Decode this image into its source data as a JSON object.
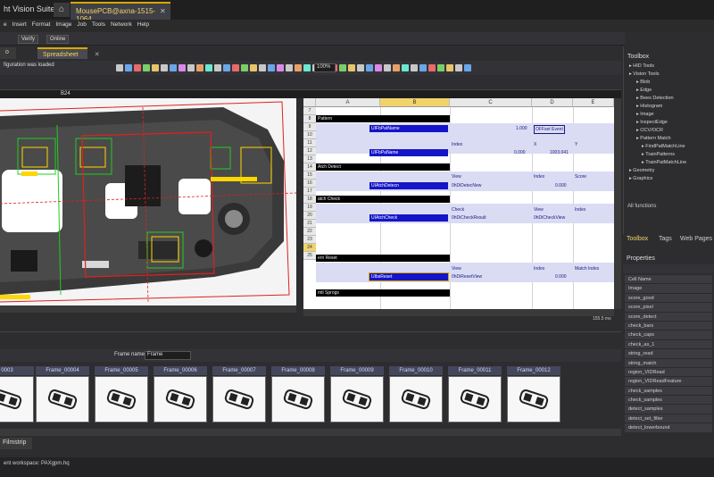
{
  "window": {
    "app_title": "ht Vision Suite",
    "doc_tab": "MousePCB@axna-1515-1064"
  },
  "menu": [
    "e",
    "Insert",
    "Format",
    "Image",
    "Job",
    "Tools",
    "Network",
    "Help"
  ],
  "toolbar": {
    "verify": "Verify",
    "online": "Online"
  },
  "tabs": [
    {
      "label": "o"
    },
    {
      "label": "Spreadsheet"
    }
  ],
  "status_message": "figuration was loaded",
  "zoom": "100%",
  "cell_ref": "B24",
  "sheet": {
    "columns": [
      "A",
      "B",
      "C",
      "D",
      "E"
    ],
    "rows": [
      "7",
      "8",
      "9",
      "10",
      "11",
      "12",
      "13",
      "14",
      "15",
      "16",
      "17",
      "18",
      "19",
      "20",
      "21",
      "22",
      "23",
      "24",
      "25"
    ],
    "bands": [
      "Pattern",
      "Atch Detect",
      "atch Check",
      "ern Reset",
      "mtl Sprogs"
    ],
    "blue_cells": [
      "UIFbPatName",
      "UIFbPaName",
      "UIAtchDetecn",
      "UIAtchCheck",
      "UIbsReset"
    ],
    "texts": {
      "r9_d": "1.000",
      "r9_e": "OFFset Event",
      "r10_c": "Index",
      "r10_d": "X",
      "r10_e": "Y",
      "r11_d": "0.000",
      "r11_e": "1003.041",
      "r13_c": "View",
      "r13_d": "Index",
      "r13_e": "Score",
      "r14_c": "0hDiDetecNew",
      "r14_e": "0.000",
      "r17_c": "Check",
      "r17_d": "View",
      "r17_e": "Index",
      "r18_c": "0hDiCheckResult",
      "r18_d": "0hDiCheckView",
      "r23_c": "View",
      "r23_d": "Index",
      "r23_e": "Match Index",
      "r24_c": "0hDiResetView",
      "r24_e": "0.000"
    }
  },
  "coord_readout": "155.5 ms",
  "filmstrip": {
    "frame_name_label": "Frame name",
    "frame_name_value": "Frame",
    "frames": [
      "0003",
      "Frame_00004",
      "Frame_00005",
      "Frame_00006",
      "Frame_00007",
      "Frame_00008",
      "Frame_00009",
      "Frame_00010",
      "Frame_00011",
      "Frame_00012"
    ],
    "tab": "Filmstrip"
  },
  "statusbar": "ent workspace: PAXgpm.hq",
  "toolbox": {
    "title": "Toolbox",
    "tree": [
      "HID Tools",
      "Vision Tools",
      "Blob",
      "Edge",
      "Bees Detection",
      "Histogram",
      "Image",
      "InspectEdge",
      "OCV/OCR",
      "Pattern Match",
      "FindPatMatchLine",
      "TrainPatterns",
      "TrainPatMatchLine",
      "Geometry",
      "Graphics"
    ],
    "all_functions": "All functions"
  },
  "pane_tabs": [
    "Toolbox",
    "Tags",
    "Web Pages"
  ],
  "properties": {
    "title": "Properties",
    "items": [
      "Cell Name",
      "Image",
      "score_good",
      "score_pixel",
      "score_detect",
      "check_bars",
      "check_caps",
      "check_as_1",
      "string_read",
      "string_match",
      "region_VIDRead",
      "region_VIDReadFeature",
      "check_samples",
      "check_samples",
      "detect_samples",
      "detect_set_filter",
      "detect_lowerbound"
    ]
  },
  "colors": {
    "accent": "#d9a800",
    "blue_cell": "#1515c8",
    "band_bg": "#dadcf4"
  }
}
